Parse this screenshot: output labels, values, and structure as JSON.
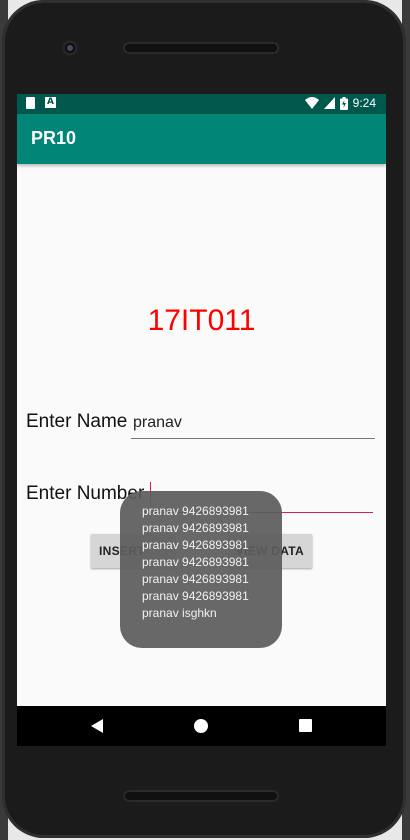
{
  "status_bar": {
    "time": "9:24",
    "notification_icon_letter": "A",
    "icons": [
      "sd-card-icon",
      "notification-a-icon",
      "wifi-icon",
      "cell-signal-icon",
      "battery-charging-icon"
    ]
  },
  "app_bar": {
    "title": "PR10",
    "color": "#008577",
    "status_color": "#00574b"
  },
  "main": {
    "code_text": "17IT011",
    "code_color": "#ff0000",
    "name_label": "Enter Name",
    "name_value": "pranav",
    "number_label": "Enter Number",
    "number_value": "",
    "insert_button": "INSERT",
    "view_button": "VIEW DATA"
  },
  "toast": {
    "lines": [
      "pranav 9426893981",
      "pranav 9426893981",
      "pranav 9426893981",
      "pranav 9426893981",
      "pranav 9426893981",
      "pranav 9426893981",
      "pranav isghkn"
    ]
  },
  "nav_bar": {
    "icons": [
      "back-icon",
      "home-icon",
      "recents-icon"
    ]
  }
}
